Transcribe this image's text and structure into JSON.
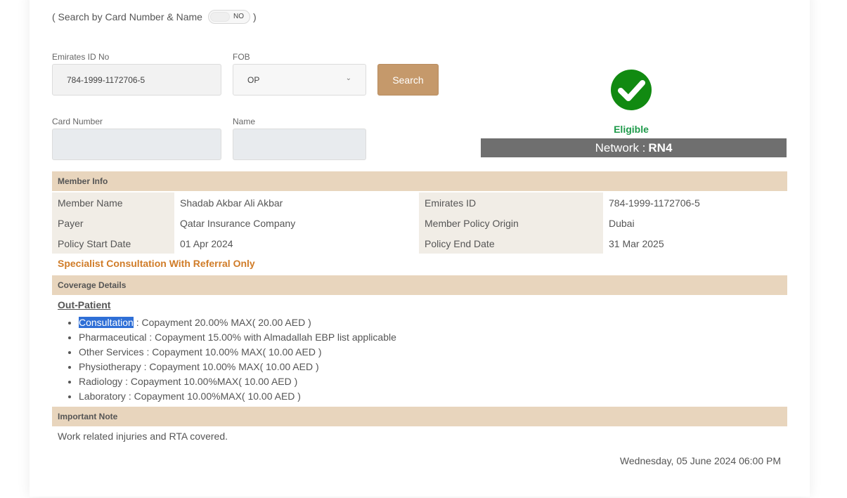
{
  "search_toggle": {
    "prefix": "( Search by Card Number & Name",
    "state": "NO",
    "suffix": ")"
  },
  "form": {
    "emirates_id_label": "Emirates ID No",
    "emirates_id_value": "784-1999-1172706-5",
    "fob_label": "FOB",
    "fob_value": "OP",
    "search_button": "Search",
    "card_number_label": "Card Number",
    "name_label": "Name"
  },
  "status": {
    "icon": "check-circle-icon",
    "eligibility": "Eligible",
    "network_label": "Network :",
    "network_value": "RN4"
  },
  "member_info": {
    "title": "Member Info",
    "rows": [
      {
        "k1": "Member Name",
        "v1": "Shadab Akbar Ali Akbar",
        "k2": "Emirates ID",
        "v2": "784-1999-1172706-5"
      },
      {
        "k1": "Payer",
        "v1": "Qatar Insurance Company",
        "k2": "Member Policy Origin",
        "v2": "Dubai"
      },
      {
        "k1": "Policy Start Date",
        "v1": "01 Apr 2024",
        "k2": "Policy End Date",
        "v2": "31 Mar 2025"
      }
    ],
    "referral_note": "Specialist Consultation With Referral Only"
  },
  "coverage": {
    "title": "Coverage Details",
    "section": "Out-Patient",
    "items": [
      {
        "name": "Consultation",
        "detail": " : Copayment 20.00% MAX( 20.00 AED )"
      },
      {
        "name": "Pharmaceutical",
        "detail": " : Copayment 15.00% with Almadallah EBP list applicable"
      },
      {
        "name": "Other Services",
        "detail": " : Copayment 10.00% MAX( 10.00 AED )"
      },
      {
        "name": "Physiotherapy",
        "detail": " : Copayment 10.00% MAX( 10.00 AED )"
      },
      {
        "name": "Radiology",
        "detail": " : Copayment 10.00%MAX( 10.00 AED )"
      },
      {
        "name": "Laboratory",
        "detail": " : Copayment 10.00%MAX( 10.00 AED )"
      }
    ]
  },
  "important_note": {
    "title": "Important Note",
    "text": "Work related injuries and RTA covered."
  },
  "timestamp": "Wednesday, 05 June 2024 06:00 PM",
  "colors": {
    "accent_button": "#c5996b",
    "section_bar": "#e8d5bd",
    "eligible_green": "#1e9a4a",
    "network_bar": "#6f6f6f",
    "referral_orange": "#d07c28",
    "selection_blue": "#2f6fd6"
  }
}
